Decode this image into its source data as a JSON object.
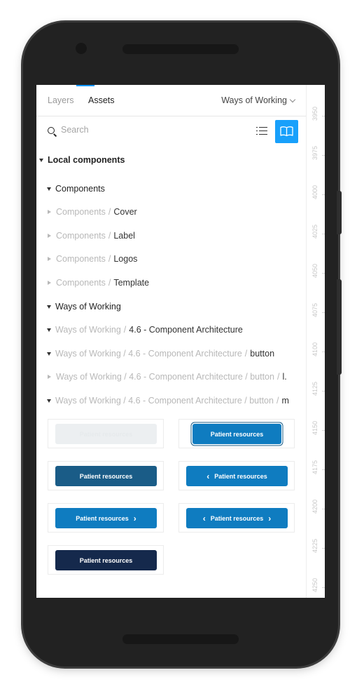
{
  "tabs": {
    "layers": "Layers",
    "assets": "Assets"
  },
  "page_selector": {
    "value": "Ways of Working"
  },
  "search": {
    "placeholder": "Search"
  },
  "tree": {
    "local": "Local components",
    "components": "Components",
    "comp_prefix": "Components",
    "cover": "Cover",
    "label": "Label",
    "logos": "Logos",
    "template": "Template",
    "wow": "Ways of Working",
    "wow_prefix": "Ways of Working",
    "arch": "4.6 - Component Architecture",
    "arch_prefix": "Ways of Working / 4.6 - Component Architecture",
    "button": "button",
    "button_prefix": "Ways of Working / 4.6 - Component Architecture / button",
    "l_item": "l.",
    "m_item": "m",
    "sep": "/"
  },
  "buttons": {
    "label": "Patient resources",
    "colors": {
      "disabled": "#eceff1",
      "primary": "#0f7cc0",
      "dark": "#1a5c87",
      "navy": "#15294c"
    }
  },
  "ruler": [
    "3950",
    "3975",
    "4000",
    "4025",
    "4050",
    "4075",
    "4100",
    "4125",
    "4150",
    "4175",
    "4200",
    "4225",
    "4250"
  ],
  "icons": [
    "search-icon",
    "list-view-icon",
    "library-book-icon",
    "chevron-down-icon",
    "chevron-left-icon",
    "chevron-right-icon"
  ]
}
